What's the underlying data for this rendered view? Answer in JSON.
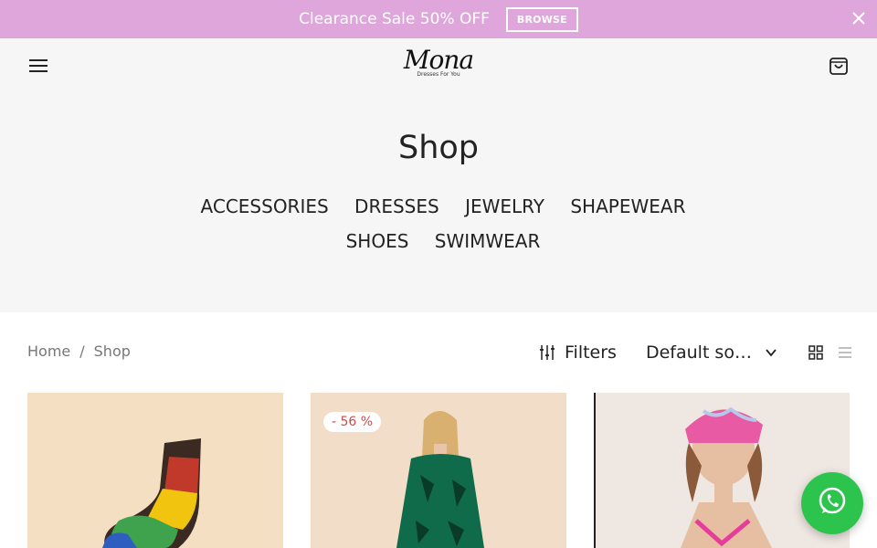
{
  "promo": {
    "text": "Clearance Sale 50% OFF",
    "button_label": "BROWSE",
    "background": "#dfa6db"
  },
  "header": {
    "logo_name": "Mona",
    "logo_tagline": "Dresses For You"
  },
  "page_title": "Shop",
  "categories": [
    {
      "label": "ACCESSORIES"
    },
    {
      "label": "DRESSES"
    },
    {
      "label": "JEWELRY"
    },
    {
      "label": "SHAPEWEAR"
    },
    {
      "label": "SHOES"
    },
    {
      "label": "SWIMWEAR"
    }
  ],
  "breadcrumb": {
    "home": "Home",
    "separator": "/",
    "current": "Shop"
  },
  "toolbar": {
    "filters_label": "Filters",
    "sort_label": "Default sorting"
  },
  "products": [
    {
      "badge": ""
    },
    {
      "badge": "- 56 %"
    },
    {
      "badge": ""
    }
  ],
  "colors": {
    "accent_pink": "#dfa6db",
    "whatsapp_green": "#2dc44d",
    "header_bg": "#f6f6f6",
    "sale_red": "#d04a4a"
  },
  "icons": [
    "close-icon",
    "hamburger-menu-icon",
    "cart-icon",
    "filters-icon",
    "chevron-down-icon",
    "grid-view-icon",
    "list-view-icon",
    "whatsapp-icon"
  ]
}
